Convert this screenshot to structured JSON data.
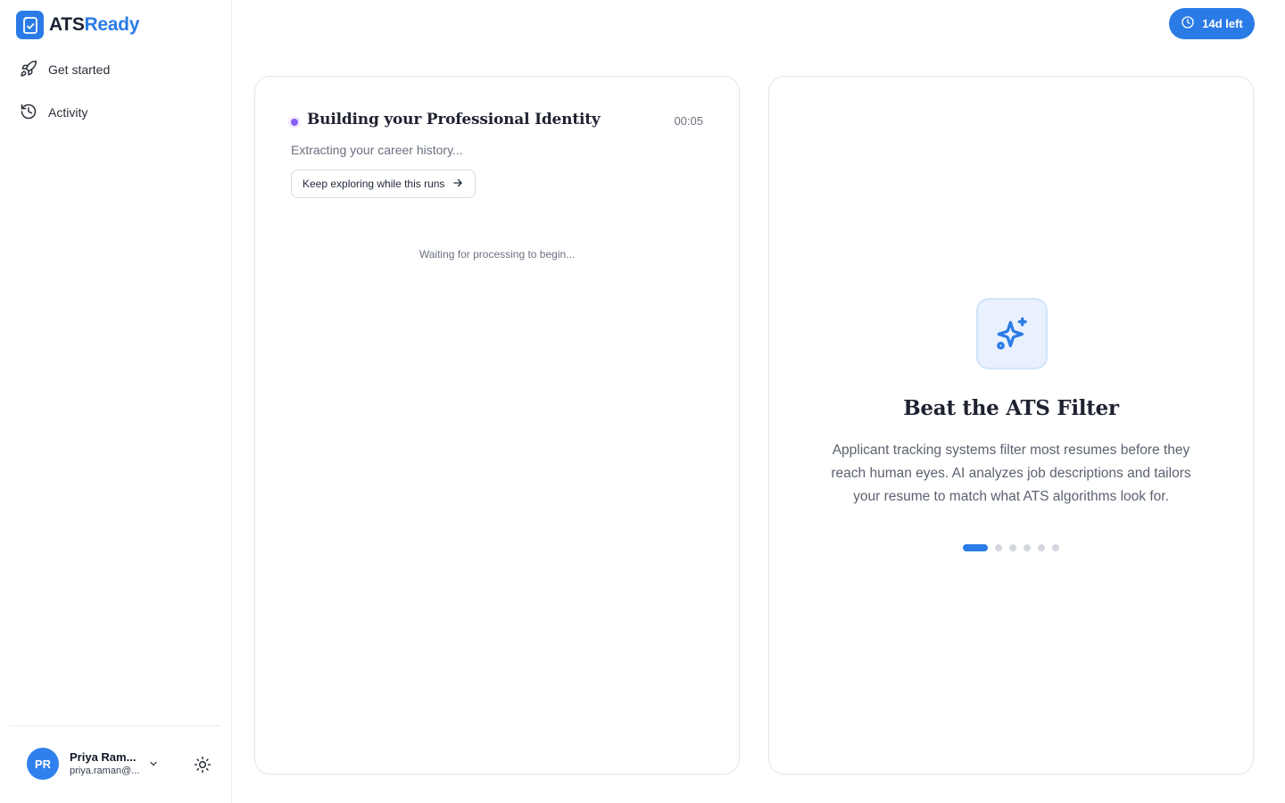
{
  "brand": {
    "name_part1": "ATS",
    "name_part2": "Ready",
    "accent_color": "#2b7be6"
  },
  "sidebar": {
    "items": [
      {
        "label": "Get started",
        "icon": "rocket-icon"
      },
      {
        "label": "Activity",
        "icon": "history-icon"
      }
    ]
  },
  "user": {
    "initials": "PR",
    "name": "Priya Ram...",
    "email": "priya.raman@..."
  },
  "trial": {
    "label": "14d left",
    "icon": "clock-icon"
  },
  "processing": {
    "title": "Building your Professional Identity",
    "timer": "00:05",
    "subtitle": "Extracting your career history...",
    "button_label": "Keep exploring while this runs",
    "status": "Waiting for processing to begin...",
    "dot_color": "#8b5cf6"
  },
  "tip": {
    "icon": "sparkles-icon",
    "title": "Beat the ATS Filter",
    "body": "Applicant tracking systems filter most resumes before they reach human eyes. AI analyzes job descriptions and tailors your resume to match what ATS algorithms look for.",
    "carousel": {
      "total": 6,
      "active_index": 0
    }
  }
}
